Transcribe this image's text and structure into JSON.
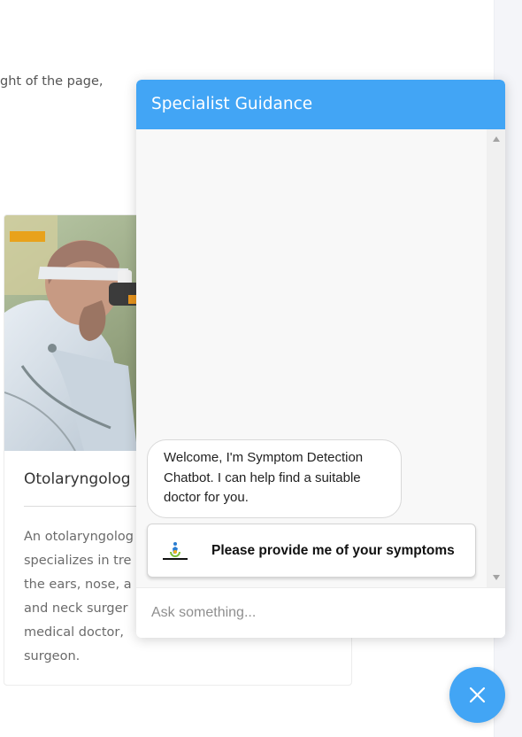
{
  "page": {
    "intro_fragment": "ght of the page,",
    "card": {
      "title": "Otolaryngolog",
      "body_lines": [
        "An otolaryngolog",
        "specializes in tre",
        "the ears, nose, a",
        "and neck surger",
        "medical doctor,",
        "surgeon."
      ]
    }
  },
  "chat": {
    "title": "Specialist Guidance",
    "messages": [
      {
        "from": "bot",
        "text": "Welcome, I'm Symptom Detection Chatbot. I can help find a suitable doctor for you."
      }
    ],
    "quick_reply": {
      "label": "Please provide me of your symptoms",
      "icon": "symptom-logo-icon"
    },
    "input": {
      "placeholder": "Ask something...",
      "value": ""
    }
  },
  "fab": {
    "icon": "close-icon"
  },
  "colors": {
    "accent": "#42a5f5",
    "background": "#ffffff",
    "chat_background": "#f8f8f8",
    "body_text": "#6b6b6b"
  }
}
